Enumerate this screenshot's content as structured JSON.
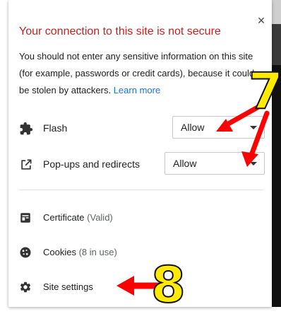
{
  "popup": {
    "title": "Your connection to this site is not secure",
    "description": "You should not enter any sensitive information on this site (for example, passwords or credit cards), because it could be stolen by attackers.",
    "learn_more": "Learn more",
    "close_symbol": "×"
  },
  "permissions": [
    {
      "label": "Flash",
      "icon": "puzzle-icon",
      "value": "Allow"
    },
    {
      "label": "Pop-ups and redirects",
      "icon": "external-link-icon",
      "value": "Allow"
    }
  ],
  "links": [
    {
      "label": "Certificate",
      "suffix": "(Valid)",
      "icon": "certificate-icon"
    },
    {
      "label": "Cookies",
      "suffix": "(8 in use)",
      "icon": "cookie-icon"
    },
    {
      "label": "Site settings",
      "suffix": "",
      "icon": "gear-icon"
    }
  ],
  "annotations": {
    "step_7": "7",
    "step_8": "8",
    "arrow_color": "#ff0000",
    "number_color": "#ffea00"
  }
}
